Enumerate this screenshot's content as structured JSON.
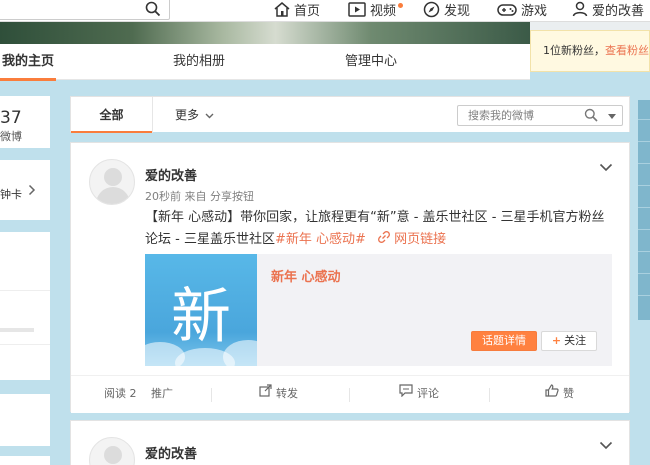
{
  "topnav": {
    "items": [
      {
        "label": "首页",
        "icon": "home-icon"
      },
      {
        "label": "视频",
        "icon": "video-icon"
      },
      {
        "label": "发现",
        "icon": "compass-icon"
      },
      {
        "label": "游戏",
        "icon": "gamepad-icon"
      },
      {
        "label": "爱的改善",
        "icon": "user-icon"
      }
    ]
  },
  "profile_tabs": {
    "items": [
      {
        "label": "我的主页",
        "active": true
      },
      {
        "label": "我的相册",
        "active": false
      },
      {
        "label": "管理中心",
        "active": false
      }
    ]
  },
  "notice": {
    "text": "1位新粉丝，",
    "link": "查看粉丝"
  },
  "left": {
    "stat_number": "37",
    "stat_label": "微博",
    "card_text": "钟卡"
  },
  "feed": {
    "tab_all": "全部",
    "tab_more": "更多",
    "search_placeholder": "搜索我的微博"
  },
  "post": {
    "author": "爱的改善",
    "meta": "20秒前 来自 分享按钮",
    "text_main": "【新年 心感动】带你回家，让旅程更有“新”意 - 盖乐世社区 - 三星手机官方粉丝论坛 - 三星盖乐世社区",
    "topic": "#新年 心感动#",
    "weblink": "网页链接",
    "card": {
      "thumb_char": "新",
      "title": "新年 心感动",
      "topic_button": "话题详情",
      "follow_button": "关注"
    },
    "actions": {
      "read": "阅读 2",
      "promote": "推广",
      "repost": "转发",
      "comment": "评论",
      "like": "赞"
    }
  },
  "post2": {
    "author": "爱的改善"
  },
  "colors": {
    "accent": "#fa7d3c",
    "link": "#eb7350",
    "background": "#bfe0ec"
  }
}
